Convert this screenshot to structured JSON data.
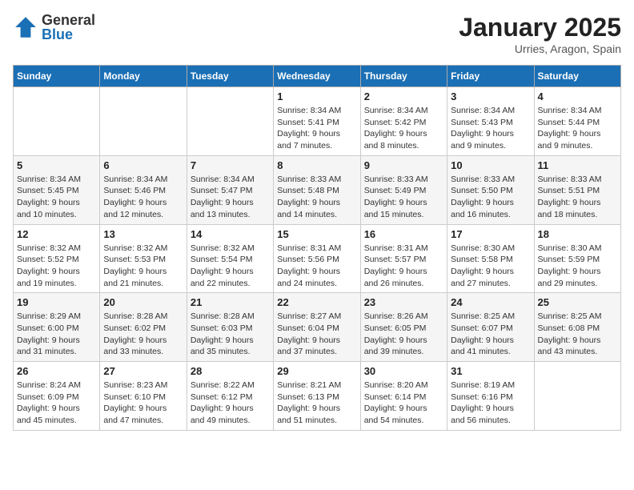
{
  "logo": {
    "general": "General",
    "blue": "Blue"
  },
  "header": {
    "month": "January 2025",
    "location": "Urries, Aragon, Spain"
  },
  "weekdays": [
    "Sunday",
    "Monday",
    "Tuesday",
    "Wednesday",
    "Thursday",
    "Friday",
    "Saturday"
  ],
  "weeks": [
    [
      {
        "day": "",
        "detail": ""
      },
      {
        "day": "",
        "detail": ""
      },
      {
        "day": "",
        "detail": ""
      },
      {
        "day": "1",
        "detail": "Sunrise: 8:34 AM\nSunset: 5:41 PM\nDaylight: 9 hours\nand 7 minutes."
      },
      {
        "day": "2",
        "detail": "Sunrise: 8:34 AM\nSunset: 5:42 PM\nDaylight: 9 hours\nand 8 minutes."
      },
      {
        "day": "3",
        "detail": "Sunrise: 8:34 AM\nSunset: 5:43 PM\nDaylight: 9 hours\nand 9 minutes."
      },
      {
        "day": "4",
        "detail": "Sunrise: 8:34 AM\nSunset: 5:44 PM\nDaylight: 9 hours\nand 9 minutes."
      }
    ],
    [
      {
        "day": "5",
        "detail": "Sunrise: 8:34 AM\nSunset: 5:45 PM\nDaylight: 9 hours\nand 10 minutes."
      },
      {
        "day": "6",
        "detail": "Sunrise: 8:34 AM\nSunset: 5:46 PM\nDaylight: 9 hours\nand 12 minutes."
      },
      {
        "day": "7",
        "detail": "Sunrise: 8:34 AM\nSunset: 5:47 PM\nDaylight: 9 hours\nand 13 minutes."
      },
      {
        "day": "8",
        "detail": "Sunrise: 8:33 AM\nSunset: 5:48 PM\nDaylight: 9 hours\nand 14 minutes."
      },
      {
        "day": "9",
        "detail": "Sunrise: 8:33 AM\nSunset: 5:49 PM\nDaylight: 9 hours\nand 15 minutes."
      },
      {
        "day": "10",
        "detail": "Sunrise: 8:33 AM\nSunset: 5:50 PM\nDaylight: 9 hours\nand 16 minutes."
      },
      {
        "day": "11",
        "detail": "Sunrise: 8:33 AM\nSunset: 5:51 PM\nDaylight: 9 hours\nand 18 minutes."
      }
    ],
    [
      {
        "day": "12",
        "detail": "Sunrise: 8:32 AM\nSunset: 5:52 PM\nDaylight: 9 hours\nand 19 minutes."
      },
      {
        "day": "13",
        "detail": "Sunrise: 8:32 AM\nSunset: 5:53 PM\nDaylight: 9 hours\nand 21 minutes."
      },
      {
        "day": "14",
        "detail": "Sunrise: 8:32 AM\nSunset: 5:54 PM\nDaylight: 9 hours\nand 22 minutes."
      },
      {
        "day": "15",
        "detail": "Sunrise: 8:31 AM\nSunset: 5:56 PM\nDaylight: 9 hours\nand 24 minutes."
      },
      {
        "day": "16",
        "detail": "Sunrise: 8:31 AM\nSunset: 5:57 PM\nDaylight: 9 hours\nand 26 minutes."
      },
      {
        "day": "17",
        "detail": "Sunrise: 8:30 AM\nSunset: 5:58 PM\nDaylight: 9 hours\nand 27 minutes."
      },
      {
        "day": "18",
        "detail": "Sunrise: 8:30 AM\nSunset: 5:59 PM\nDaylight: 9 hours\nand 29 minutes."
      }
    ],
    [
      {
        "day": "19",
        "detail": "Sunrise: 8:29 AM\nSunset: 6:00 PM\nDaylight: 9 hours\nand 31 minutes."
      },
      {
        "day": "20",
        "detail": "Sunrise: 8:28 AM\nSunset: 6:02 PM\nDaylight: 9 hours\nand 33 minutes."
      },
      {
        "day": "21",
        "detail": "Sunrise: 8:28 AM\nSunset: 6:03 PM\nDaylight: 9 hours\nand 35 minutes."
      },
      {
        "day": "22",
        "detail": "Sunrise: 8:27 AM\nSunset: 6:04 PM\nDaylight: 9 hours\nand 37 minutes."
      },
      {
        "day": "23",
        "detail": "Sunrise: 8:26 AM\nSunset: 6:05 PM\nDaylight: 9 hours\nand 39 minutes."
      },
      {
        "day": "24",
        "detail": "Sunrise: 8:25 AM\nSunset: 6:07 PM\nDaylight: 9 hours\nand 41 minutes."
      },
      {
        "day": "25",
        "detail": "Sunrise: 8:25 AM\nSunset: 6:08 PM\nDaylight: 9 hours\nand 43 minutes."
      }
    ],
    [
      {
        "day": "26",
        "detail": "Sunrise: 8:24 AM\nSunset: 6:09 PM\nDaylight: 9 hours\nand 45 minutes."
      },
      {
        "day": "27",
        "detail": "Sunrise: 8:23 AM\nSunset: 6:10 PM\nDaylight: 9 hours\nand 47 minutes."
      },
      {
        "day": "28",
        "detail": "Sunrise: 8:22 AM\nSunset: 6:12 PM\nDaylight: 9 hours\nand 49 minutes."
      },
      {
        "day": "29",
        "detail": "Sunrise: 8:21 AM\nSunset: 6:13 PM\nDaylight: 9 hours\nand 51 minutes."
      },
      {
        "day": "30",
        "detail": "Sunrise: 8:20 AM\nSunset: 6:14 PM\nDaylight: 9 hours\nand 54 minutes."
      },
      {
        "day": "31",
        "detail": "Sunrise: 8:19 AM\nSunset: 6:16 PM\nDaylight: 9 hours\nand 56 minutes."
      },
      {
        "day": "",
        "detail": ""
      }
    ]
  ]
}
